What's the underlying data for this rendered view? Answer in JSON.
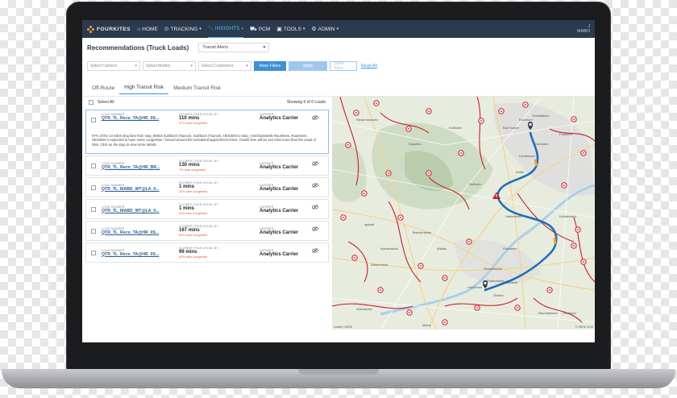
{
  "app": {
    "brand": "FOURKITES",
    "user": {
      "line1": "J",
      "line2": "MABDI"
    }
  },
  "nav": [
    {
      "label": "HOME",
      "icon": "home-icon",
      "caret": false
    },
    {
      "label": "TRACKING",
      "icon": "location-pin-icon",
      "caret": true
    },
    {
      "label": "INSIGHTS",
      "icon": "trend-icon",
      "caret": true,
      "active": true
    },
    {
      "label": "PCM",
      "icon": "truck-network-icon",
      "caret": false
    },
    {
      "label": "TOOLS",
      "icon": "toolbox-icon",
      "caret": true
    },
    {
      "label": "ADMIN",
      "icon": "gear-icon",
      "caret": true
    }
  ],
  "header": {
    "title": "Recommendations (Truck Loads)",
    "alert_select": "Transit Alerts"
  },
  "filters": {
    "carriers_placeholder": "Select Carriers",
    "modes_placeholder": "Select Modes",
    "customers_placeholder": "Select Customers",
    "more_filters": "More Filters",
    "apply": "Apply",
    "save_filter": "Save Filter",
    "reset_all": "Reset All"
  },
  "tabs": [
    {
      "label": "Off-Route",
      "active": false
    },
    {
      "label": "High Transit Risk",
      "active": true
    },
    {
      "label": "Medium Transit Risk",
      "active": false
    }
  ],
  "list": {
    "select_all": "Select All",
    "showing": "Showing 6 of 6 Loads",
    "col_load": "LOAD NUMBER",
    "col_slower": "SLOWER THAN USUAL BY",
    "col_carrier": "CARRIER",
    "items": [
      {
        "load": "QTR_TL_Reco_TA@HR_0S...",
        "mins": "110 mins",
        "pct": "47% lane congested",
        "carrier": "Analytics Carrier",
        "desc": "97% of the 13 miles long lane from stop_60843 Sulzbach (Taunus), Sulzbach (Taunus), HESSEN to stop_Anschlussstelle Raunheim, Raunheim, HESSEN is expected to have some congestion / hazard around the scheduled appointment times. Transit time will be 110 mins more than the usual of 29m. Click on the stop to view more details"
      },
      {
        "load": "QTR_TL_Reco_TA@HR_BR...",
        "mins": "130 mins",
        "pct": "7% lane congested",
        "carrier": "Analytics Carrier"
      },
      {
        "load": "QTR_TL_MABD_WT@LA_0...",
        "mins": "1 mins",
        "pct": "32% lane congested",
        "carrier": "Analytics Carrier"
      },
      {
        "load": "QTR_TL_MABD_WT@LA_0...",
        "mins": "1 mins",
        "pct": "32% lane congested",
        "carrier": "Analytics Carrier"
      },
      {
        "load": "QTR_TL_Reco_TA@HR_0S...",
        "mins": "167 mins",
        "pct": "84% lane congested",
        "carrier": "Analytics Carrier"
      },
      {
        "load": "QTR_TL_Reco_TA@HR_0S...",
        "mins": "99 mins",
        "pct": "59% lane congested",
        "carrier": "Analytics Carrier"
      }
    ]
  },
  "map": {
    "attribution": "Leaflet | HERE",
    "copyright": "© HERE 2019",
    "places": [
      "Eschborn",
      "Frankfurt",
      "Bad Soden",
      "Hofheim",
      "Sulzbach",
      "Hattersheim",
      "Kelsterbach",
      "Flörsheim",
      "Rüsselsheim",
      "Raunheim",
      "Wiesbaden",
      "Mainz",
      "Kriftel",
      "Liederbach",
      "Schwalbach",
      "Eddersheim",
      "Bischofsheim",
      "Ginsheim",
      "Delkenheim",
      "Hochheim",
      "Okriftel",
      "Niedernhausen",
      "Kelkheim",
      "Eppstein",
      "Nordenstadt",
      "Wallau",
      "Breckenheim",
      "Igstadt"
    ],
    "route_color": "#1f6fb8",
    "incident_color": "#c81e2a"
  }
}
